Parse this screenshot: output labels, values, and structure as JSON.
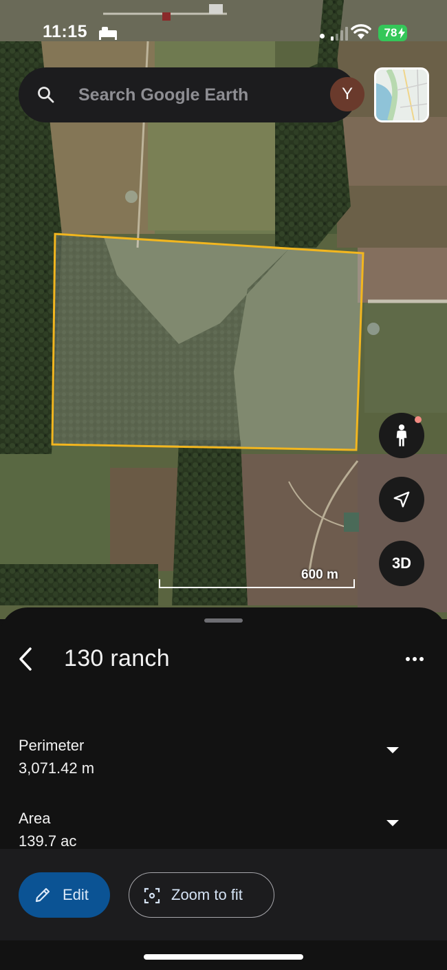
{
  "status_bar": {
    "time": "11:15",
    "battery": "78",
    "icons": [
      "sleep-focus-icon",
      "signal-icon",
      "wifi-icon",
      "battery-icon"
    ]
  },
  "search": {
    "placeholder": "Search Google Earth",
    "avatar_initial": "Y"
  },
  "map": {
    "scale_label": "600 m",
    "polygon_color": "#f2b61f",
    "buttons": {
      "pegman": "pegman-icon",
      "locate": "navigation-arrow-icon",
      "three_d_label": "3D"
    }
  },
  "sheet": {
    "title": "130 ranch",
    "measurements": [
      {
        "label": "Perimeter",
        "value": "3,071.42 m"
      },
      {
        "label": "Area",
        "value": "139.7 ac"
      }
    ],
    "actions": {
      "edit_label": "Edit",
      "zoom_label": "Zoom to fit"
    }
  },
  "colors": {
    "accent": "#0b5394",
    "sheet_bg": "#121212",
    "action_bar_bg": "#1c1c1e",
    "battery": "#34c759"
  }
}
